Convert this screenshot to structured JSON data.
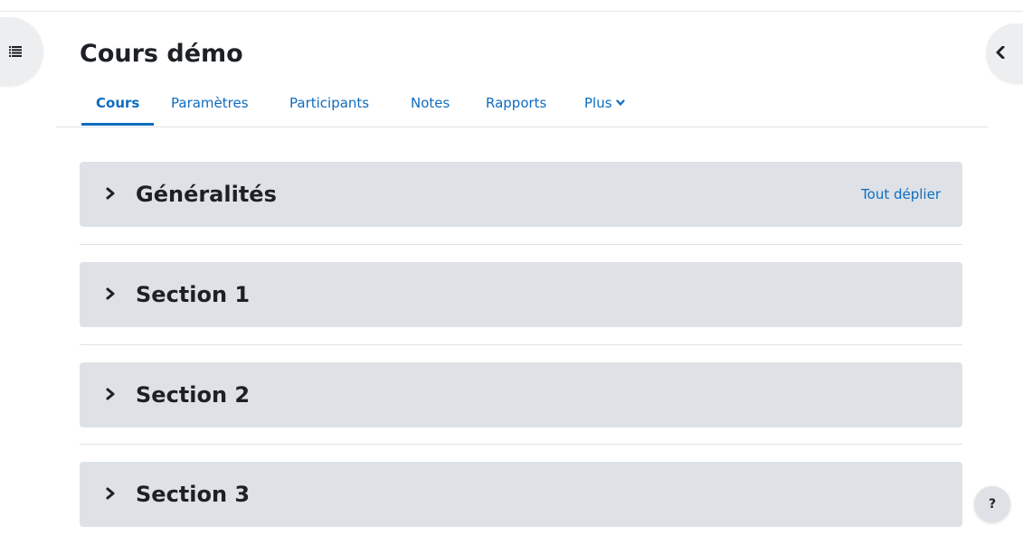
{
  "course": {
    "title": "Cours démo"
  },
  "tabs": [
    {
      "label": "Cours",
      "active": true
    },
    {
      "label": "Paramètres",
      "active": false
    },
    {
      "label": "Participants",
      "active": false
    },
    {
      "label": "Notes",
      "active": false
    },
    {
      "label": "Rapports",
      "active": false
    },
    {
      "label": "Plus",
      "active": false,
      "icon": "chevron-down-icon"
    }
  ],
  "sections": [
    {
      "title": "Généralités",
      "collapsed": true,
      "icon": "chevron-right-icon"
    },
    {
      "title": "Section 1",
      "collapsed": true,
      "icon": "chevron-right-icon"
    },
    {
      "title": "Section 2",
      "collapsed": true,
      "icon": "chevron-right-icon"
    },
    {
      "title": "Section 3",
      "collapsed": true,
      "icon": "chevron-right-icon"
    }
  ],
  "actions": {
    "expand_all": "Tout déplier"
  },
  "drawers": {
    "left_icon": "course-index-icon",
    "right_icon": "chevron-left-icon"
  },
  "help": {
    "label": "?"
  },
  "colors": {
    "accent": "#0f6cbf",
    "section_bg": "#dee2e6",
    "text": "#1d2125"
  }
}
